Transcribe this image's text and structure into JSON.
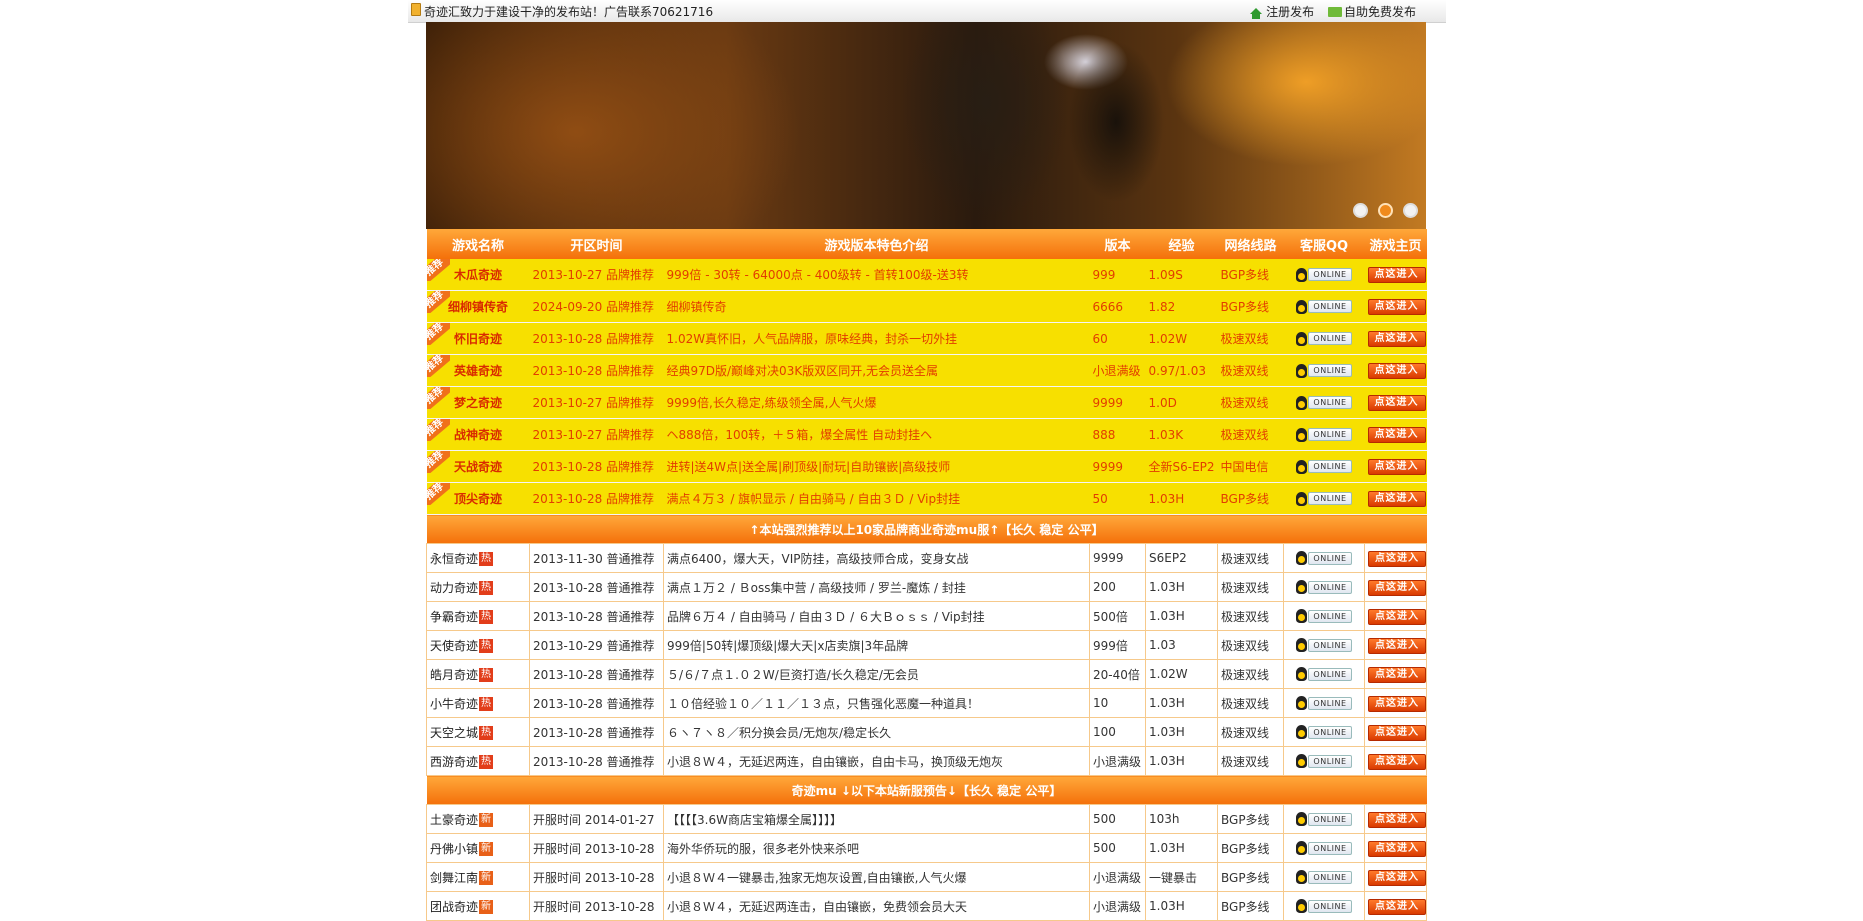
{
  "topbar": {
    "notice": "奇迹汇致力于建设干净的发布站！广告联系70621716",
    "register_link": "注册发布",
    "free_link": "自助免费发布"
  },
  "banner": {
    "slides": 3,
    "active": 2
  },
  "table_header": [
    "游戏名称",
    "开区时间",
    "游戏版本特色介绍",
    "版本",
    "经验",
    "网络线路",
    "客服QQ",
    "游戏主页"
  ],
  "qq_label": "ONLINE",
  "enter_label": "点这进入",
  "ribbon_label": "推荐",
  "hot_label": "热",
  "new_label": "新",
  "recommended_rows": [
    {
      "name": "木瓜奇迹",
      "time": "2013-10-27 品牌推荐",
      "desc": "999倍 - 30转 - 64000点 - 400级转 - 首转100级-送3转",
      "version": "999",
      "exp": "1.09S",
      "line": "BGP多线"
    },
    {
      "name": "细柳镇传奇",
      "time": "2024-09-20 品牌推荐",
      "desc": "细柳镇传奇",
      "version": "6666",
      "exp": "1.82",
      "line": "BGP多线"
    },
    {
      "name": "怀旧奇迹",
      "time": "2013-10-28 品牌推荐",
      "desc": "1.02W真怀旧，人气品牌服，原味经典，封杀一切外挂",
      "version": "60",
      "exp": "1.02W",
      "line": "极速双线"
    },
    {
      "name": "英雄奇迹",
      "time": "2013-10-28 品牌推荐",
      "desc": "经典97D版/巅峰对决03K版双区同开,无会员送全属",
      "version": "小退满级",
      "exp": "0.97/1.03",
      "line": "极速双线"
    },
    {
      "name": "梦之奇迹",
      "time": "2013-10-27 品牌推荐",
      "desc": "9999倍,长久稳定,练级领全属,人气火爆",
      "version": "9999",
      "exp": "1.0D",
      "line": "极速双线"
    },
    {
      "name": "战神奇迹",
      "time": "2013-10-27 品牌推荐",
      "desc": "ヘ888倍，100转，＋５箱，爆全属性 自动封挂ヘ",
      "version": "888",
      "exp": "1.03K",
      "line": "极速双线"
    },
    {
      "name": "天战奇迹",
      "time": "2013-10-28 品牌推荐",
      "desc": "进转|送4W点|送全属|刷顶级|耐玩|自助镶嵌|高级技师",
      "version": "9999",
      "exp": "全新S6-EP2",
      "line": "中国电信"
    },
    {
      "name": "顶尖奇迹",
      "time": "2013-10-28 品牌推荐",
      "desc": "满点４万３ / 旗帜显示 / 自由骑马 / 自由３Ｄ / Vip封挂",
      "version": "50",
      "exp": "1.03H",
      "line": "BGP多线"
    }
  ],
  "section1_title": "↑本站强烈推荐以上10家品牌商业奇迹mu服↑【长久 稳定 公平】",
  "normal_rows": [
    {
      "name": "永恒奇迹",
      "time": "2013-11-30 普通推荐",
      "desc": "满点6400，爆大天，VIP防挂，高级技师合成，变身女战",
      "version": "9999",
      "exp": "S6EP2",
      "line": "极速双线"
    },
    {
      "name": "动力奇迹",
      "time": "2013-10-28 普通推荐",
      "desc": "满点１万２ / Ｂoss集中营 / 高级技师 / 罗兰-魔炼 / 封挂",
      "version": "200",
      "exp": "1.03H",
      "line": "极速双线"
    },
    {
      "name": "争霸奇迹",
      "time": "2013-10-28 普通推荐",
      "desc": "品牌６万４ / 自由骑马 / 自由３Ｄ / ６大Ｂｏｓｓ / Vip封挂",
      "version": "500倍",
      "exp": "1.03H",
      "line": "极速双线"
    },
    {
      "name": "天使奇迹",
      "time": "2013-10-29 普通推荐",
      "desc": "999倍|50转|爆顶级|爆大天|x店卖旗|3年品牌",
      "version": "999倍",
      "exp": "1.03",
      "line": "极速双线"
    },
    {
      "name": "皓月奇迹",
      "time": "2013-10-28 普通推荐",
      "desc": "５/６/７点１.０２W/巨资打造/长久稳定/无会员",
      "version": "20-40倍",
      "exp": "1.02W",
      "line": "极速双线"
    },
    {
      "name": "小牛奇迹",
      "time": "2013-10-28 普通推荐",
      "desc": "１０倍经验１０／１１／１３点，只售强化恶魔一种道具！",
      "version": "10",
      "exp": "1.03H",
      "line": "极速双线"
    },
    {
      "name": "天空之城",
      "time": "2013-10-28 普通推荐",
      "desc": "６ヽ７ヽ８／积分换会员/无炮灰/稳定长久",
      "version": "100",
      "exp": "1.03H",
      "line": "极速双线"
    },
    {
      "name": "西游奇迹",
      "time": "2013-10-28 普通推荐",
      "desc": "小退８Ｗ４，无延迟两连，自由镶嵌，自由卡马，换顶级无炮灰",
      "version": "小退满级",
      "exp": "1.03H",
      "line": "极速双线"
    }
  ],
  "section2_title": "奇迹mu ↓以下本站新服预告↓【长久 稳定 公平】",
  "new_rows": [
    {
      "name": "土豪奇迹",
      "time": "开服时间 2014-01-27",
      "desc": "【【【【3.6W商店宝箱爆全属】】】】",
      "version": "500",
      "exp": "103h",
      "line": "BGP多线"
    },
    {
      "name": "丹佛小镇",
      "time": "开服时间 2013-10-28",
      "desc": "海外华侨玩的服，很多老外快来杀吧",
      "version": "500",
      "exp": "1.03H",
      "line": "BGP多线"
    },
    {
      "name": "剑舞江南",
      "time": "开服时间 2013-10-28",
      "desc": "小退８Ｗ４一键暴击,独家无炮灰设置,自由镶嵌,人气火爆",
      "version": "小退满级",
      "exp": "一键暴击",
      "line": "BGP多线"
    },
    {
      "name": "团战奇迹",
      "time": "开服时间 2013-10-28",
      "desc": "小退８Ｗ４，无延迟两连击，自由镶嵌，免费领会员大天",
      "version": "小退满级",
      "exp": "1.03H",
      "line": "BGP多线"
    }
  ]
}
